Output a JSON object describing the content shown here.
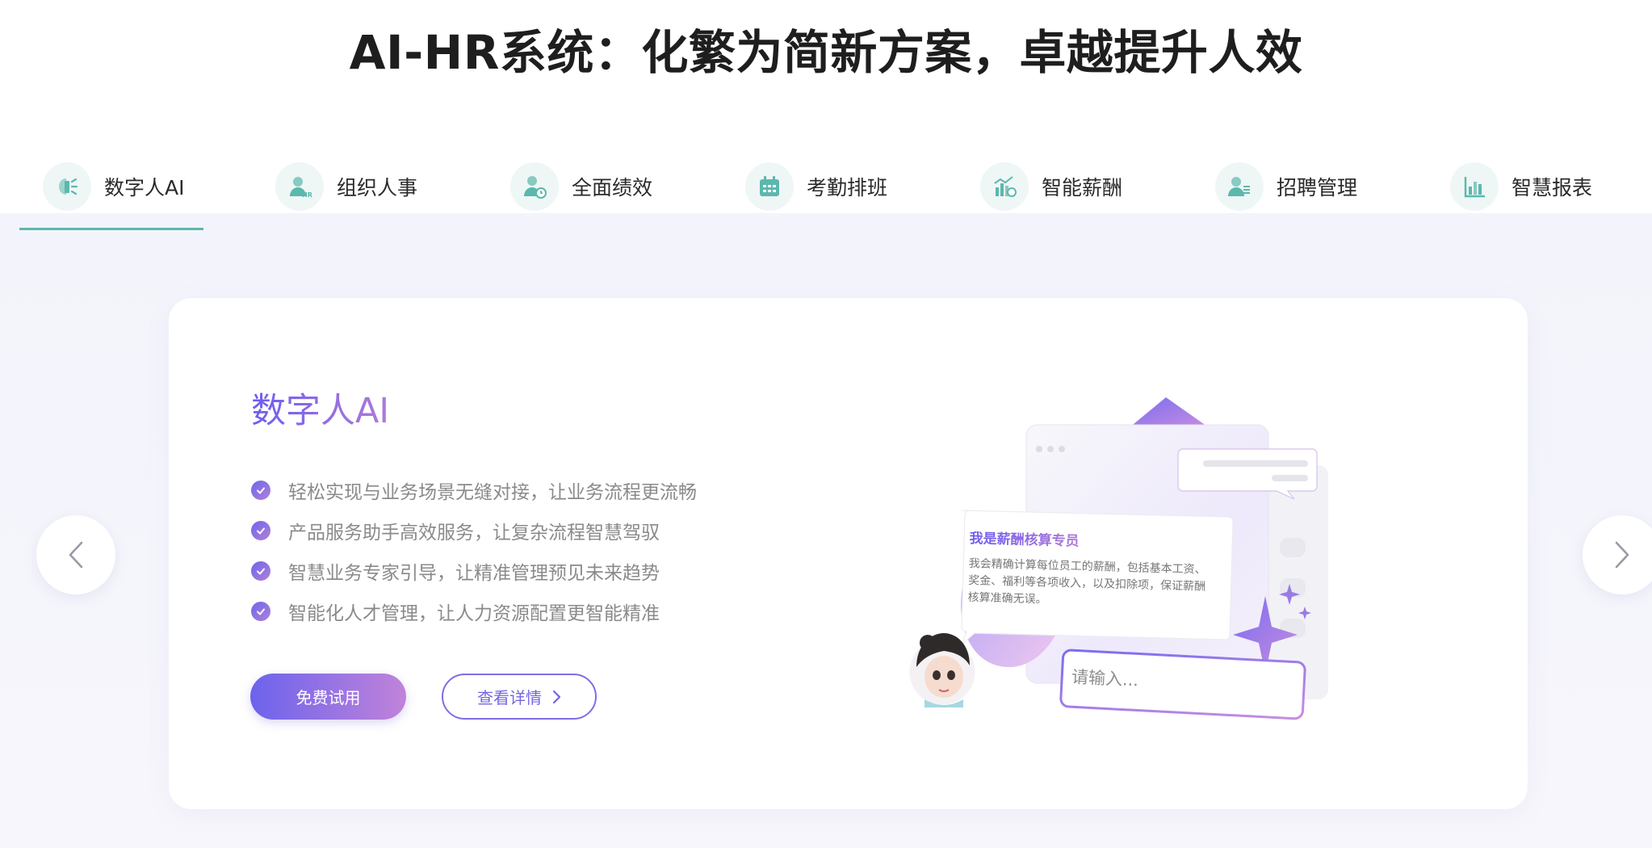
{
  "headline": "AI-HR系统：化繁为简新方案，卓越提升人效",
  "tabs": [
    {
      "label": "数字人AI",
      "icon": "digital-human-icon",
      "active": true
    },
    {
      "label": "组织人事",
      "icon": "org-personnel-icon",
      "active": false
    },
    {
      "label": "全面绩效",
      "icon": "performance-icon",
      "active": false
    },
    {
      "label": "考勤排班",
      "icon": "calendar-icon",
      "active": false
    },
    {
      "label": "智能薪酬",
      "icon": "salary-chart-icon",
      "active": false
    },
    {
      "label": "招聘管理",
      "icon": "recruitment-icon",
      "active": false
    },
    {
      "label": "智慧报表",
      "icon": "report-chart-icon",
      "active": false
    }
  ],
  "card": {
    "title": "数字人AI",
    "features": [
      "轻松实现与业务场景无缝对接，让业务流程更流畅",
      "产品服务助手高效服务，让复杂流程智慧驾驭",
      "智慧业务专家引导，让精准管理预见未来趋势",
      "智能化人才管理，让人力资源配置更智能精准"
    ],
    "primary_button": "免费试用",
    "secondary_button": "查看详情"
  },
  "illustration": {
    "chat_title": "我是薪酬核算专员",
    "chat_body": "我会精确计算每位员工的薪酬，包括基本工资、奖金、福利等各项收入，以及扣除项，保证薪酬核算准确无误。",
    "input_placeholder": "请输入..."
  },
  "colors": {
    "tab_accent": "#5bb8ad",
    "tab_icon_bg": "#eef7f6",
    "gradient_start": "#6c63ec",
    "gradient_end": "#c083da",
    "band_bg": "#f3f4fb"
  }
}
